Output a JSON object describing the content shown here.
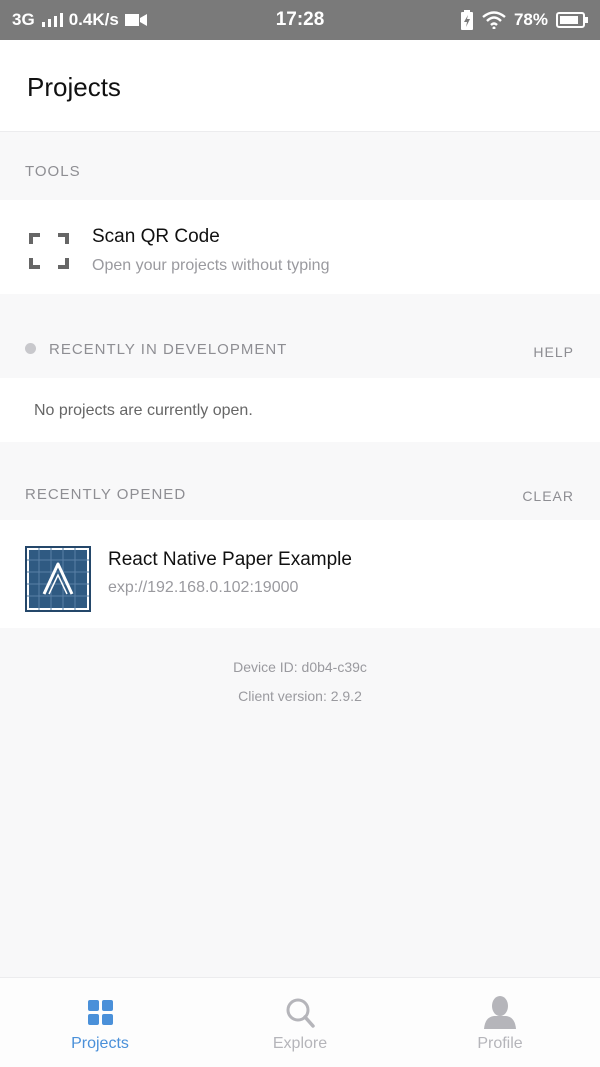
{
  "status_bar": {
    "network": "3G",
    "speed": "0.4K/s",
    "time": "17:28",
    "battery": "78%"
  },
  "header": {
    "title": "Projects"
  },
  "tools": {
    "label": "TOOLS",
    "scan_title": "Scan QR Code",
    "scan_subtitle": "Open your projects without typing"
  },
  "recent_dev": {
    "label": "RECENTLY IN DEVELOPMENT",
    "action": "HELP",
    "empty_text": "No projects are currently open."
  },
  "recent_opened": {
    "label": "RECENTLY OPENED",
    "action": "CLEAR",
    "items": [
      {
        "title": "React Native Paper Example",
        "url": "exp://192.168.0.102:19000"
      }
    ]
  },
  "footer": {
    "device_id": "Device ID: d0b4-c39c",
    "client_version": "Client version: 2.9.2"
  },
  "tabs": [
    {
      "label": "Projects",
      "active": true
    },
    {
      "label": "Explore",
      "active": false
    },
    {
      "label": "Profile",
      "active": false
    }
  ],
  "colors": {
    "accent": "#4a90d9",
    "inactive": "#b5b5ba",
    "thumb_bg": "#2f5a82"
  }
}
